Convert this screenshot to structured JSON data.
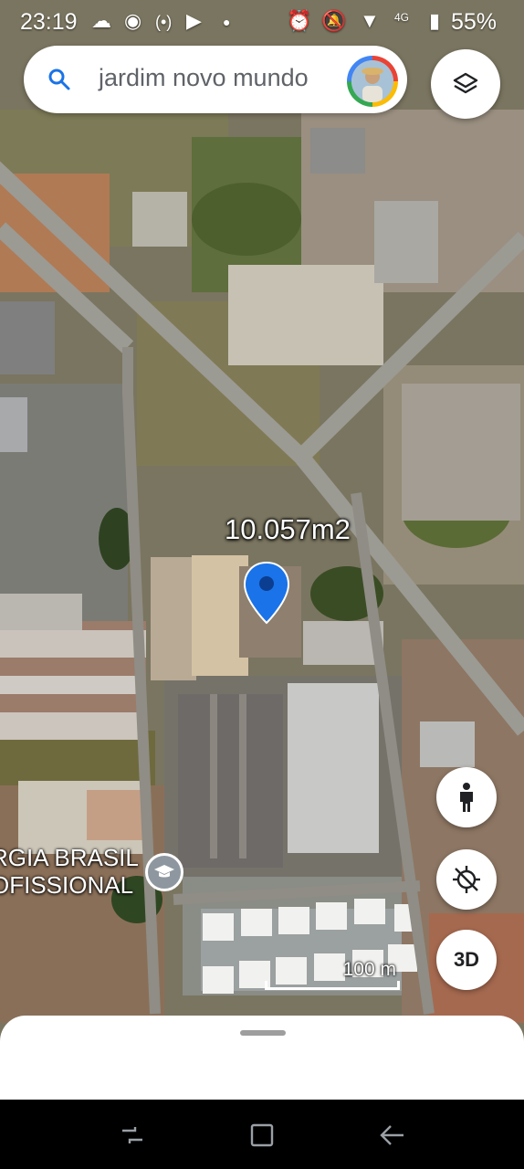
{
  "status_bar": {
    "time": "23:19",
    "icons": [
      "cloud-sync-icon",
      "eye-icon",
      "hotspot-icon",
      "youtube-icon",
      "dot-icon",
      "alarm-icon",
      "mute-icon",
      "wifi-icon",
      "lte-icon",
      "battery-icon"
    ],
    "battery": "55%"
  },
  "search": {
    "text": "jardim novo mundo",
    "icon": "search-icon"
  },
  "map": {
    "area_label": "10.057m2",
    "place_label_line1": "RGIA BRASIL",
    "place_label_line2": "OFISSIONAL",
    "place_icon": "graduation-cap-icon",
    "scale_label": "100 m",
    "pin_color": "#1a73e8"
  },
  "buttons": {
    "layers_icon": "layers-icon",
    "street_view_icon": "pegman-icon",
    "locate_icon": "location-disabled-icon",
    "three_d_label": "3D"
  },
  "nav_bar": {
    "icons": [
      "recents-icon",
      "home-icon",
      "back-icon"
    ]
  }
}
